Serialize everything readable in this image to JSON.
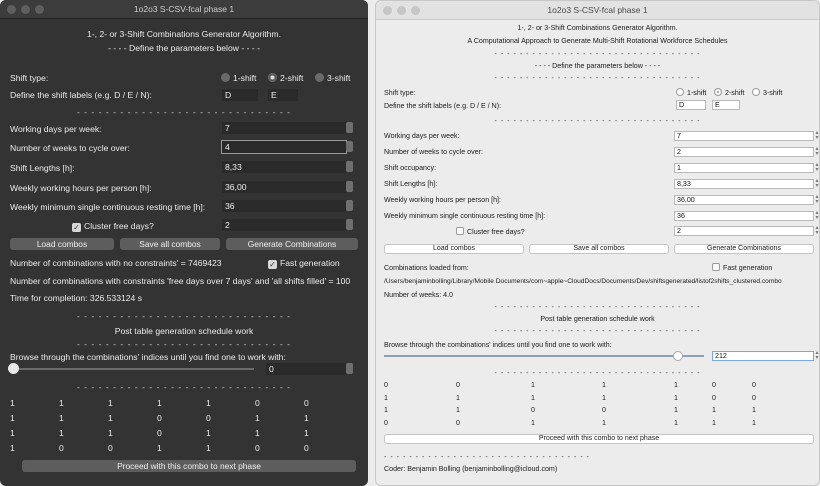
{
  "dark": {
    "window_title": "1o2o3 S-CSV-fcal phase 1",
    "heading": "1-, 2- or 3-Shift Combinations Generator Algorithm.",
    "subheading": "- - - - Define the parameters below - - - -",
    "shift_type_label": "Shift type:",
    "shift_options": [
      "1-shift",
      "2-shift",
      "3-shift"
    ],
    "shift_labels_label": "Define the shift labels (e.g. D / E / N):",
    "shift_label_values": [
      "D",
      "E"
    ],
    "separator": "- - - - - - - - - - - - - - - - - - - - - - - - - - - - - -",
    "params": [
      {
        "label": "Working days per week:",
        "value": "7"
      },
      {
        "label": "Number of weeks to cycle over:",
        "value": "4"
      },
      {
        "label": "Shift Lengths [h]:",
        "value": "8,33"
      },
      {
        "label": "Weekly working hours per person [h]:",
        "value": "36,00"
      },
      {
        "label": "Weekly minimum single continuous resting time [h]:",
        "value": "36"
      }
    ],
    "cluster_label": "Cluster free days?",
    "cluster_value": "2",
    "buttons": {
      "load": "Load combos",
      "save": "Save all combos",
      "generate": "Generate Combinations"
    },
    "no_constraints_text": "Number of combinations with no constraints' = 7469423",
    "fast_generation_label": "Fast generation",
    "with_constraints_text": "Number of combinations with constraints 'free days over 7 days' and 'all shifts filled' = 100",
    "completion_text": "Time for completion: 326.533124 s",
    "post_heading": "Post table generation schedule work",
    "browse_text": "Browse through the combinations' indices until you find one to work with:",
    "slider_value": "0",
    "table": [
      [
        "1",
        "1",
        "1",
        "1",
        "1",
        "0",
        "0"
      ],
      [
        "1",
        "1",
        "1",
        "0",
        "0",
        "1",
        "1"
      ],
      [
        "1",
        "1",
        "1",
        "0",
        "1",
        "1",
        "1"
      ],
      [
        "1",
        "0",
        "0",
        "1",
        "1",
        "0",
        "0"
      ]
    ],
    "proceed_label": "Proceed with this combo to next phase"
  },
  "light": {
    "window_title": "1o2o3 S-CSV-fcal phase 1",
    "heading": "1-, 2- or 3-Shift Combinations Generator Algorithm.",
    "heading2": "A Computational Approach to Generate Multi-Shift Rotational Workforce Schedules",
    "separator": "- - - - - - - - - - - - - - - - - - - - - - - - - - - - - - - - -",
    "subheading": "- - - - Define the parameters below - - - -",
    "shift_type_label": "Shift type:",
    "shift_options": [
      "1-shift",
      "2-shift",
      "3-shift"
    ],
    "shift_labels_label": "Define the shift labels (e.g. D / E / N):",
    "shift_label_values": [
      "D",
      "E"
    ],
    "params": [
      {
        "label": "Working days per week:",
        "value": "7"
      },
      {
        "label": "Number of weeks to cycle over:",
        "value": "2"
      },
      {
        "label": "Shift occupancy:",
        "value": "1"
      },
      {
        "label": "Shift Lengths [h]:",
        "value": "8,33"
      },
      {
        "label": "Weekly working hours per person [h]:",
        "value": "36,00"
      },
      {
        "label": "Weekly minimum single continuous resting time [h]:",
        "value": "36"
      }
    ],
    "cluster_label": "Cluster free days?",
    "cluster_value": "2",
    "buttons": {
      "load": "Load combos",
      "save": "Save all combos",
      "generate": "Generate Combinations"
    },
    "loaded_from_label": "Combinations loaded from:",
    "fast_generation_label": "Fast generation",
    "loaded_path": "/Users/benjaminbolling/Library/Mobile Documents/com~apple~CloudDocs/Documents/Dev/shiftsgenerated/listof2shifts_clustered.combo",
    "weeks_text": "Number of weeks: 4.0",
    "post_heading": "Post table generation schedule work",
    "browse_text": "Browse through the combinations' indices until you find one to work with:",
    "slider_value": "212",
    "slider_fraction": 0.92,
    "table": [
      [
        "0",
        "0",
        "1",
        "1",
        "1",
        "0",
        "0"
      ],
      [
        "1",
        "1",
        "1",
        "1",
        "1",
        "0",
        "0"
      ],
      [
        "1",
        "1",
        "0",
        "0",
        "1",
        "1",
        "1"
      ],
      [
        "0",
        "0",
        "1",
        "1",
        "1",
        "1",
        "1"
      ]
    ],
    "proceed_label": "Proceed with this combo to next phase",
    "coder_text": "Coder: Benjamin Bolling (benjaminbolling@icloud.com)"
  }
}
